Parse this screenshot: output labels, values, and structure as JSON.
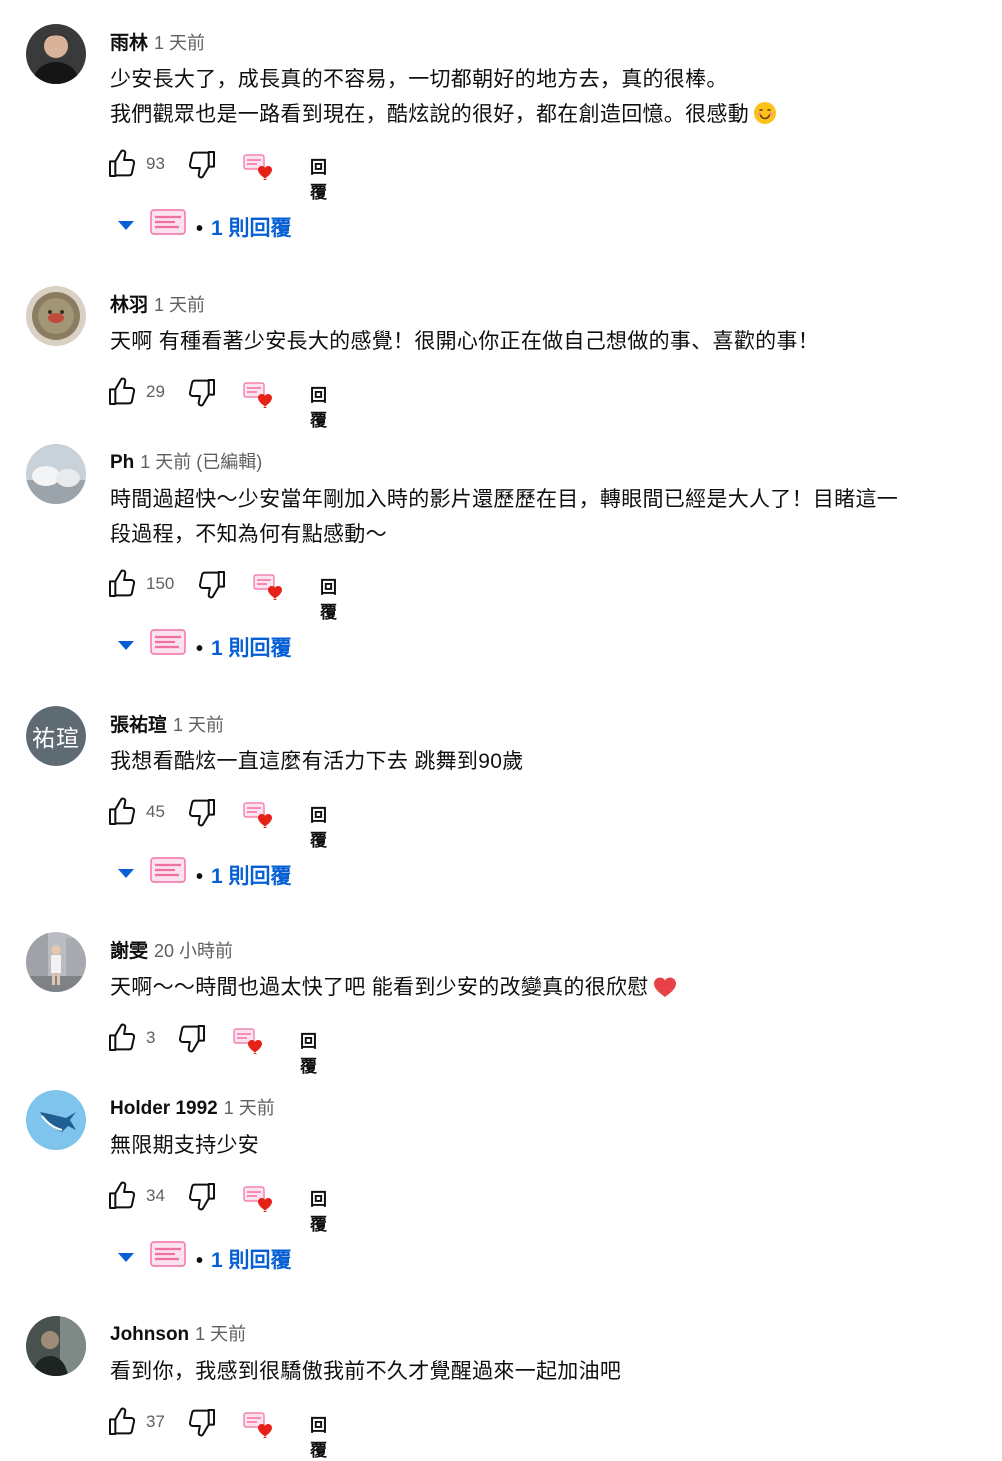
{
  "colors": {
    "accent": "#065fd4",
    "secondary_text": "#606060",
    "heart": "#e62117",
    "creator_pink": "#f06fa5"
  },
  "icons": {
    "like": "thumb-up-icon",
    "dislike": "thumb-down-icon",
    "creator_heart": "creator-heart-icon",
    "expand": "chevron-down-icon"
  },
  "comments": [
    {
      "author": "雨林",
      "time": "1 天前",
      "lines": [
        "少安長大了，成長真的不容易，一切都朝好的地方去，真的很棒。",
        "我們觀眾也是一路看到現在，酷炫說的很好，都在創造回憶。很感動"
      ],
      "likes": "93",
      "reply_label": "回覆",
      "replies_label": "1 則回覆",
      "dot": "•"
    },
    {
      "author": "林羽",
      "time": "1 天前",
      "lines": [
        "天啊 有種看著少安長大的感覺！很開心你正在做自己想做的事、喜歡的事！"
      ],
      "likes": "29",
      "reply_label": "回覆"
    },
    {
      "author": "Ph",
      "time": "1 天前 (已編輯)",
      "lines": [
        "時間過超快～少安當年剛加入時的影片還歷歷在目，轉眼間已經是大人了！目睹這一",
        "段過程，不知為何有點感動～"
      ],
      "likes": "150",
      "reply_label": "回覆",
      "replies_label": "1 則回覆",
      "dot": "•"
    },
    {
      "author": "張祐瑄",
      "time": "1 天前",
      "avatar_text": "祐瑄",
      "lines": [
        "我想看酷炫一直這麼有活力下去 跳舞到90歲"
      ],
      "likes": "45",
      "reply_label": "回覆",
      "replies_label": "1 則回覆",
      "dot": "•"
    },
    {
      "author": "謝雯",
      "time": "20 小時前",
      "lines": [
        "天啊～～時間也過太快了吧 能看到少安的改變真的很欣慰"
      ],
      "likes": "3",
      "reply_label": "回覆"
    },
    {
      "author": "Holder 1992",
      "time": "1 天前",
      "lines": [
        "無限期支持少安"
      ],
      "likes": "34",
      "reply_label": "回覆",
      "replies_label": "1 則回覆",
      "dot": "•"
    },
    {
      "author": "Johnson",
      "time": "1 天前",
      "lines": [
        "看到你，我感到很驕傲我前不久才覺醒過來一起加油吧"
      ],
      "likes": "37",
      "reply_label": "回覆"
    }
  ]
}
